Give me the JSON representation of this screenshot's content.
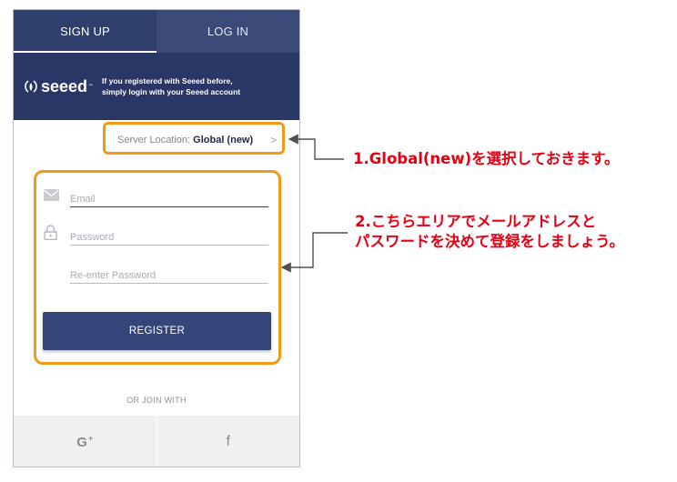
{
  "tabs": [
    {
      "label": "SIGN UP",
      "active": true
    },
    {
      "label": "LOG IN",
      "active": false
    }
  ],
  "brand": {
    "logo_text": "seeed",
    "logo_tm": "™",
    "message_line1": "If you registered with Seeed before,",
    "message_line2": "simply login with your Seeed account"
  },
  "server": {
    "label": "Server Location: ",
    "value": "Global (new)",
    "chevron": ">"
  },
  "form": {
    "email_placeholder": "Email",
    "password_placeholder": "Password",
    "reenter_placeholder": "Re-enter Password",
    "register_label": "REGISTER"
  },
  "social": {
    "or_join_label": "OR JOIN WITH",
    "google_label": "G",
    "google_plus": "+",
    "facebook_label": "f"
  },
  "annotations": {
    "note1": "1.Global(new)を選択しておきます。",
    "note2_line1": "2.こちらエリアでメールアドレスと",
    "note2_line2": "パスワードを決めて登録をしましょう。"
  },
  "colors": {
    "header": "#2f3f6d",
    "brand_band": "#2a3766",
    "highlight": "#f29a17",
    "annotation": "#e60012",
    "register": "#34457a"
  }
}
